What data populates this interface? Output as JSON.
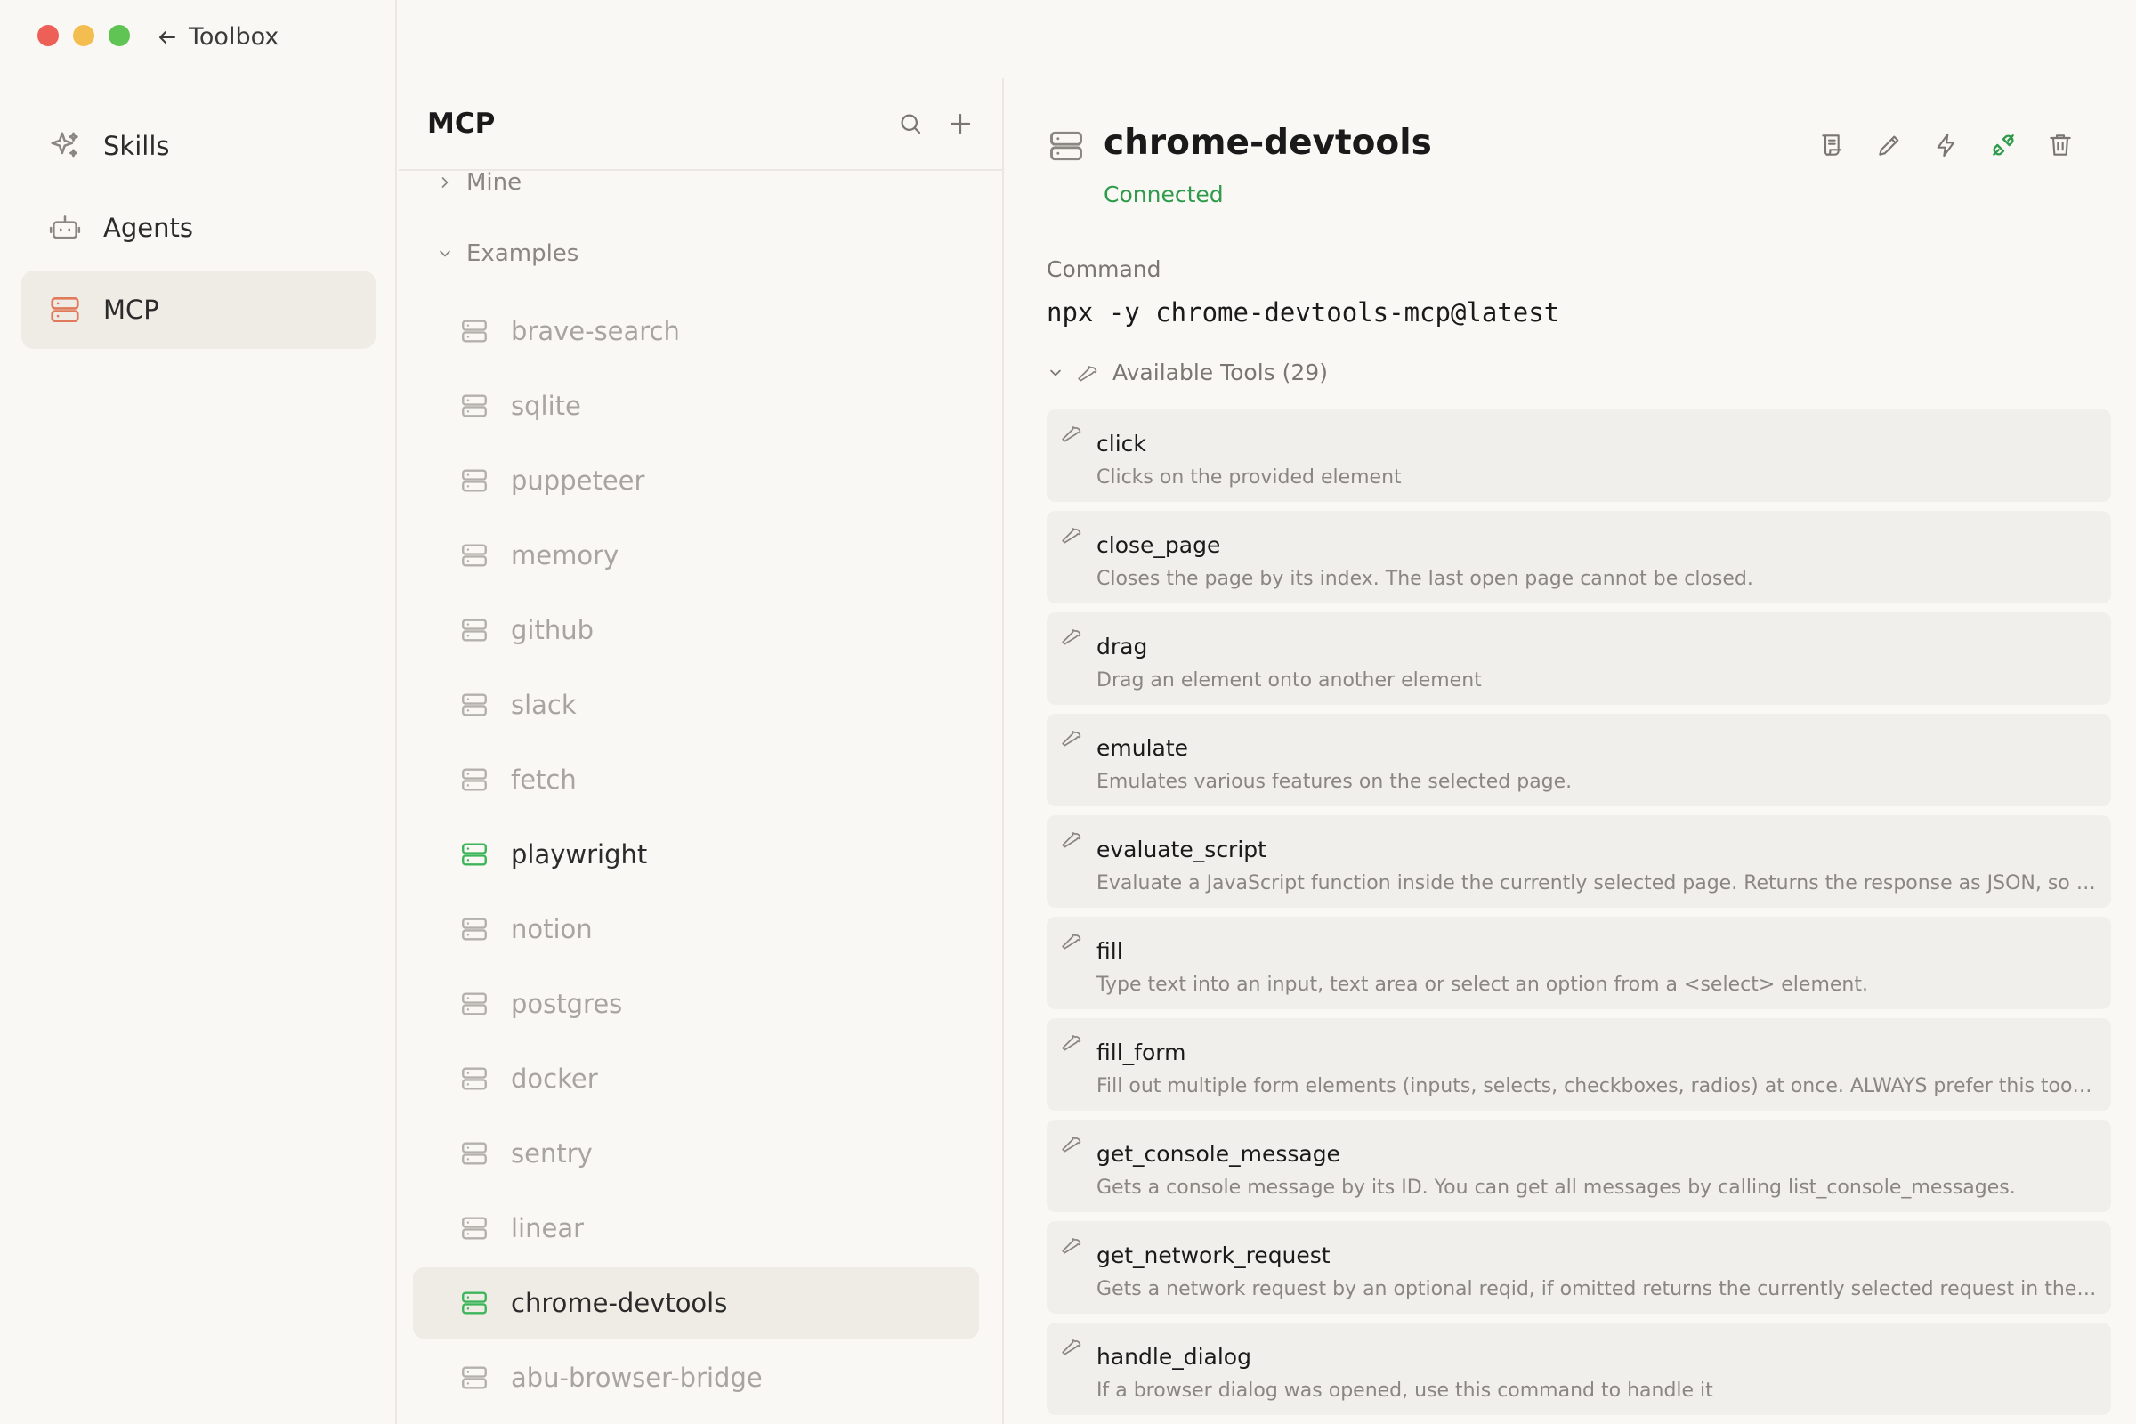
{
  "window": {
    "back_label": "Toolbox"
  },
  "colors": {
    "accent_orange": "#e07a5a",
    "connected_green": "#2e9a4b",
    "inactive_gray": "#b4b1ac"
  },
  "nav": {
    "items": [
      {
        "label": "Skills",
        "icon": "sparkles-icon"
      },
      {
        "label": "Agents",
        "icon": "robot-icon"
      },
      {
        "label": "MCP",
        "icon": "server-icon",
        "active": true
      }
    ]
  },
  "list": {
    "title": "MCP",
    "groups": {
      "mine": "Mine",
      "examples": "Examples"
    },
    "servers": [
      "brave-search",
      "sqlite",
      "puppeteer",
      "memory",
      "github",
      "slack",
      "fetch",
      "playwright",
      "notion",
      "postgres",
      "docker",
      "sentry",
      "linear",
      "chrome-devtools",
      "abu-browser-bridge"
    ],
    "connected": [
      "playwright",
      "chrome-devtools"
    ],
    "selected": "chrome-devtools"
  },
  "detail": {
    "title": "chrome-devtools",
    "status": "Connected",
    "command_label": "Command",
    "command": "npx -y chrome-devtools-mcp@latest",
    "tools_label": "Available Tools (29)",
    "tools": [
      {
        "name": "click",
        "desc": "Clicks on the provided element"
      },
      {
        "name": "close_page",
        "desc": "Closes the page by its index. The last open page cannot be closed."
      },
      {
        "name": "drag",
        "desc": "Drag an element onto another element"
      },
      {
        "name": "emulate",
        "desc": "Emulates various features on the selected page."
      },
      {
        "name": "evaluate_script",
        "desc": "Evaluate a JavaScript function inside the currently selected page. Returns the response as JSON, so r..."
      },
      {
        "name": "fill",
        "desc": "Type text into an input, text area or select an option from a <select> element."
      },
      {
        "name": "fill_form",
        "desc": "Fill out multiple form elements (inputs, selects, checkboxes, radios) at once. ALWAYS prefer this tool o..."
      },
      {
        "name": "get_console_message",
        "desc": "Gets a console message by its ID. You can get all messages by calling list_console_messages."
      },
      {
        "name": "get_network_request",
        "desc": "Gets a network request by an optional reqid, if omitted returns the currently selected request in the De..."
      },
      {
        "name": "handle_dialog",
        "desc": "If a browser dialog was opened, use this command to handle it"
      }
    ]
  }
}
